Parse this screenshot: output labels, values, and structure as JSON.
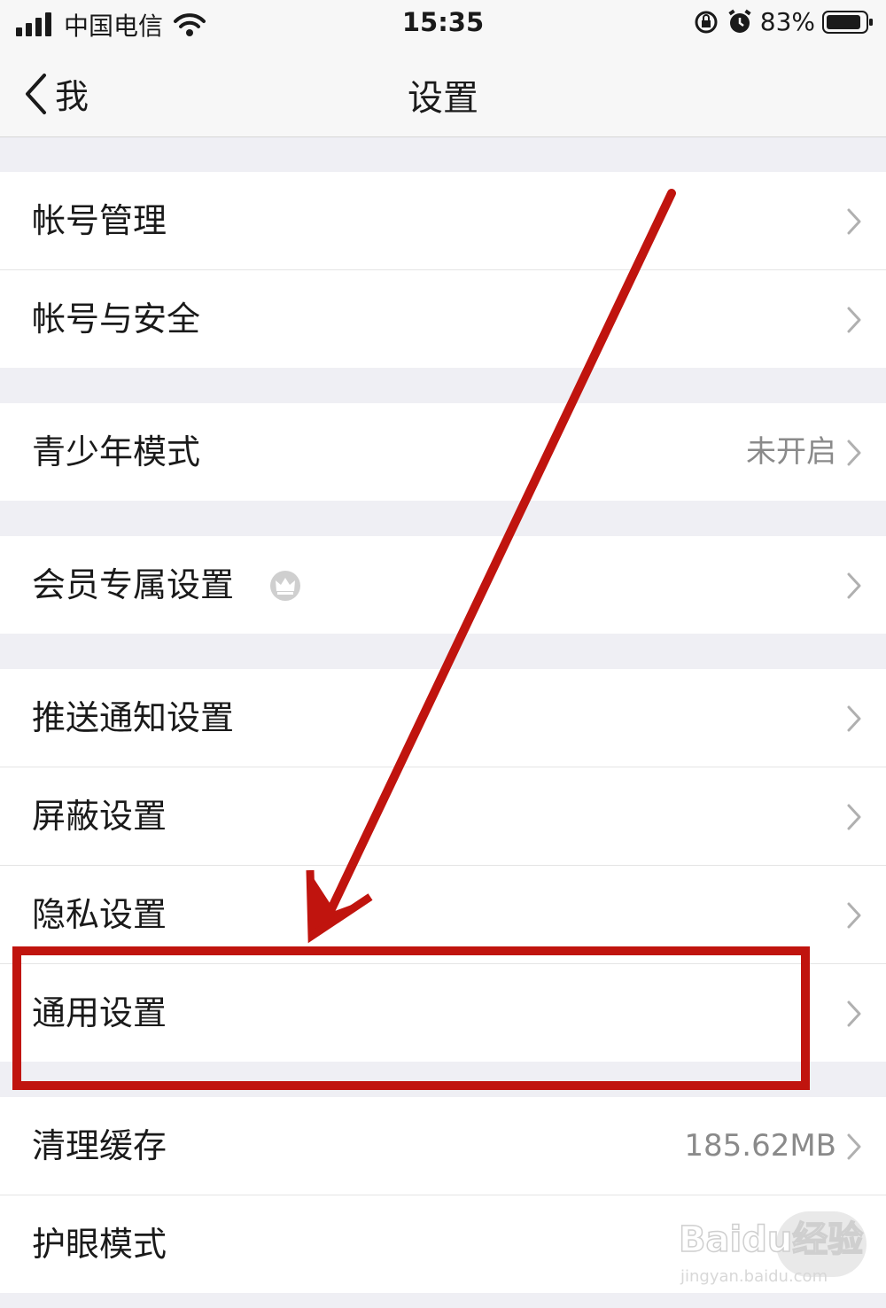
{
  "status_bar": {
    "carrier": "中国电信",
    "time": "15:35",
    "battery": "83%"
  },
  "nav": {
    "back_label": "我",
    "title": "设置"
  },
  "rows": [
    {
      "label": "帐号管理",
      "value": ""
    },
    {
      "label": "帐号与安全",
      "value": ""
    },
    {
      "label": "青少年模式",
      "value": "未开启"
    },
    {
      "label": "会员专属设置",
      "value": ""
    },
    {
      "label": "推送通知设置",
      "value": ""
    },
    {
      "label": "屏蔽设置",
      "value": ""
    },
    {
      "label": "隐私设置",
      "value": ""
    },
    {
      "label": "通用设置",
      "value": ""
    },
    {
      "label": "清理缓存",
      "value": "185.62MB"
    },
    {
      "label": "护眼模式",
      "value": ""
    }
  ],
  "annotation": {
    "color": "#c0140e",
    "highlighted_row": "通用设置"
  },
  "watermark": {
    "text": "Baidu经验",
    "sub": "jingyan.baidu.com"
  },
  "icons": [
    "signal-icon",
    "wifi-icon",
    "rotation-lock-icon",
    "alarm-icon",
    "battery-icon",
    "back-chevron-icon",
    "chevron-right-icon",
    "crown-icon"
  ]
}
